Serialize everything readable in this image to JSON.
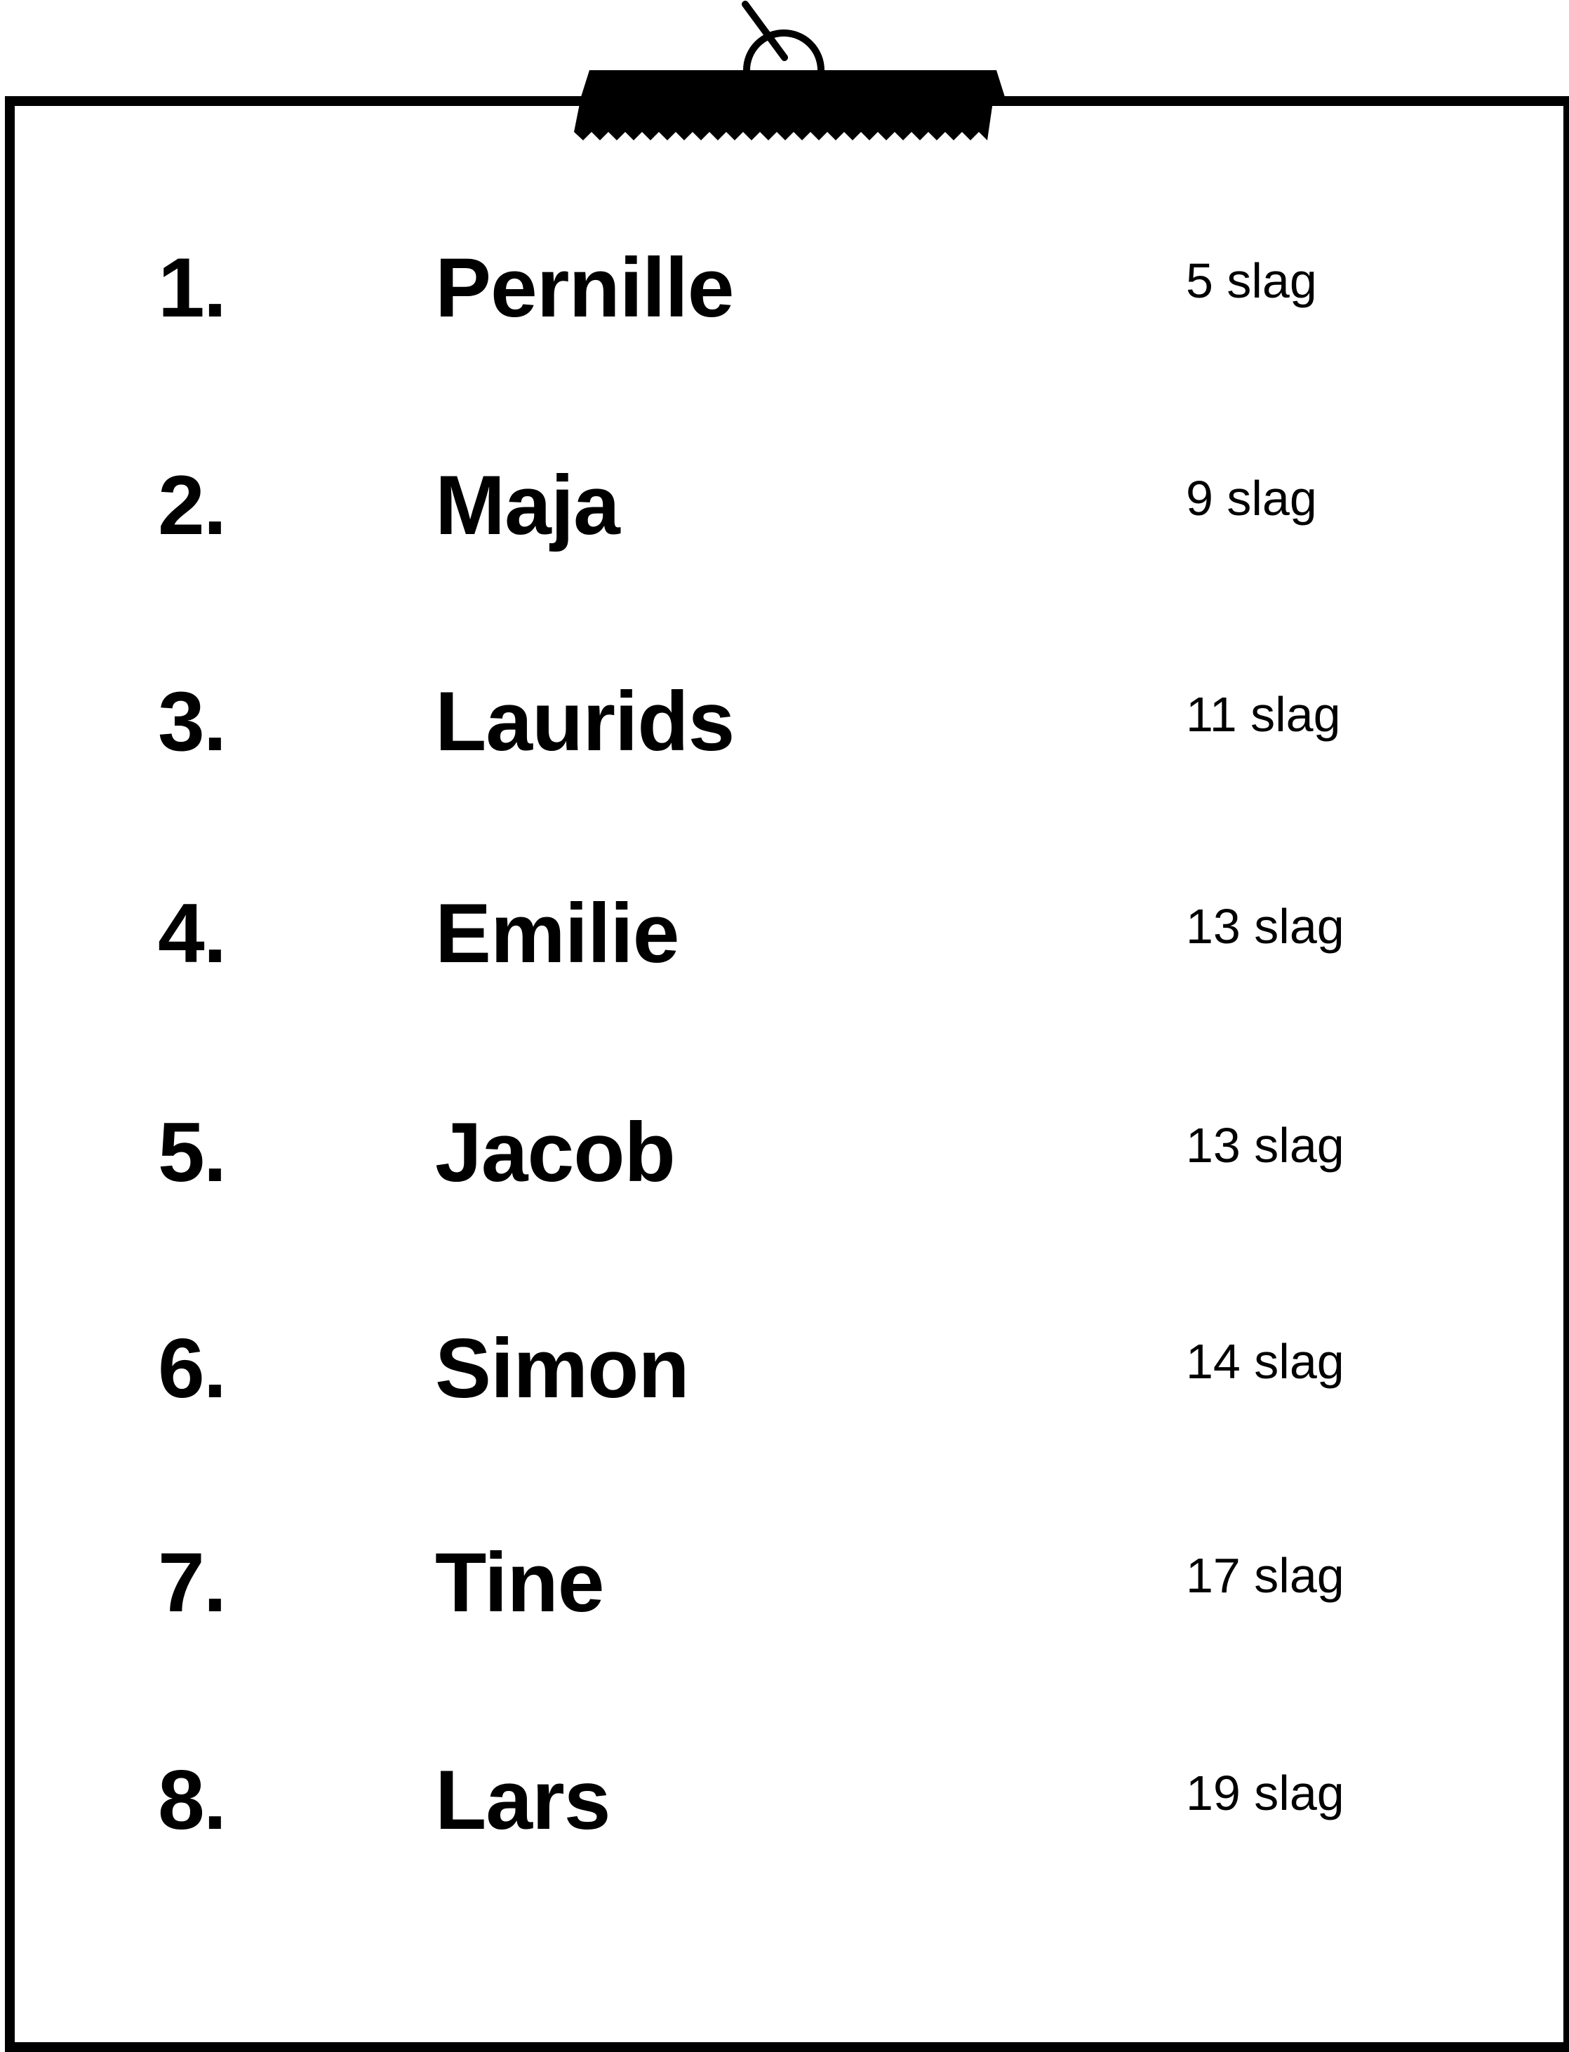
{
  "leaderboard": {
    "unit": "slag",
    "entries": [
      {
        "rank": "1.",
        "name": "Pernille",
        "score": "5 slag"
      },
      {
        "rank": "2.",
        "name": "Maja",
        "score": "9 slag"
      },
      {
        "rank": "3.",
        "name": "Laurids",
        "score": "11 slag"
      },
      {
        "rank": "4.",
        "name": "Emilie",
        "score": "13 slag"
      },
      {
        "rank": "5.",
        "name": "Jacob",
        "score": "13 slag"
      },
      {
        "rank": "6.",
        "name": "Simon",
        "score": "14 slag"
      },
      {
        "rank": "7.",
        "name": "Tine",
        "score": "17 slag"
      },
      {
        "rank": "8.",
        "name": "Lars",
        "score": "19 slag"
      }
    ]
  },
  "colors": {
    "ink": "#000000",
    "paper": "#ffffff"
  },
  "icons": {
    "clip": "clipboard-clip-icon",
    "hanger": "pin-hanger-icon"
  }
}
